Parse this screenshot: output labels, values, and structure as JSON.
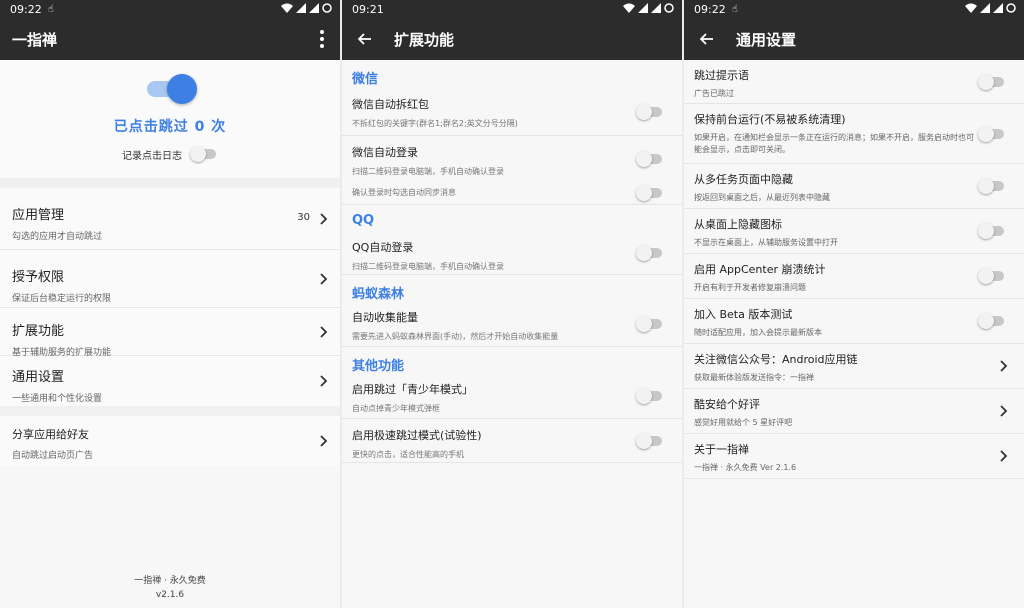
{
  "status": {
    "time_1": "09:22",
    "time_2": "09:21",
    "time_3": "09:22"
  },
  "main": {
    "title": "一指禅",
    "counter": "已点击跳过 0 次",
    "log_label": "记录点击日志",
    "items": [
      {
        "title": "应用管理",
        "subtitle": "勾选的应用才自动跳过",
        "count": "30"
      },
      {
        "title": "授予权限",
        "subtitle": "保证后台稳定运行的权限"
      },
      {
        "title": "扩展功能",
        "subtitle": "基于辅助服务的扩展功能"
      },
      {
        "title": "通用设置",
        "subtitle": "一些通用和个性化设置"
      },
      {
        "title": "分享应用给好友",
        "subtitle": "自动跳过启动页广告"
      }
    ],
    "footer_line1": "一指禅 · 永久免费",
    "footer_line2": "v2.1.6"
  },
  "extensions": {
    "title": "扩展功能",
    "sections": [
      {
        "header": "微信",
        "rows": [
          {
            "title": "微信自动拆红包",
            "subtitle": "不拆红包的关键字(群名1;群名2;英文分号分隔)"
          },
          {
            "title": "微信自动登录",
            "subtitle": "扫描二维码登录电脑端，手机自动确认登录"
          },
          {
            "subtitle": "确认登录时勾选自动同步消息"
          }
        ]
      },
      {
        "header": "QQ",
        "rows": [
          {
            "title": "QQ自动登录",
            "subtitle": "扫描二维码登录电脑端，手机自动确认登录"
          }
        ]
      },
      {
        "header": "蚂蚁森林",
        "rows": [
          {
            "title": "自动收集能量",
            "subtitle": "需要先进入蚂蚁森林界面(手动)，然后才开始自动收集能量"
          }
        ]
      },
      {
        "header": "其他功能",
        "rows": [
          {
            "title": "启用跳过「青少年模式」",
            "subtitle": "自动点掉青少年模式弹框"
          },
          {
            "title": "启用极速跳过模式(试验性)",
            "subtitle": "更快的点击，适合性能高的手机"
          }
        ]
      }
    ]
  },
  "settings": {
    "title": "通用设置",
    "rows": [
      {
        "title": "跳过提示语",
        "subtitle": "广告已跳过"
      },
      {
        "title": "保持前台运行(不易被系统清理)",
        "subtitle": "如果开启，在通知栏会显示一条正在运行的消息；如果不开启，服务启动时也可能会显示，点击即可关闭。"
      },
      {
        "title": "从多任务页面中隐藏",
        "subtitle": "按返回到桌面之后，从最近列表中隐藏"
      },
      {
        "title": "从桌面上隐藏图标",
        "subtitle": "不显示在桌面上，从辅助服务设置中打开"
      },
      {
        "title": "启用 AppCenter 崩溃统计",
        "subtitle": "开启有利于开发者修复崩溃问题"
      },
      {
        "title": "加入 Beta 版本测试",
        "subtitle": "随时适配应用，加入会提示最新版本"
      },
      {
        "title": "关注微信公众号：Android应用链",
        "subtitle": "获取最新体验版发送指令：一指禅"
      },
      {
        "title": "酷安给个好评",
        "subtitle": "感觉好用就给个 5 星好评吧"
      },
      {
        "title": "关于一指禅",
        "subtitle": "一指禅 · 永久免费 Ver 2.1.6"
      }
    ]
  },
  "colors": {
    "bar": "#2c2c2c",
    "accent": "#3d7fe3",
    "switch_off_track": "#c8c8c8"
  }
}
